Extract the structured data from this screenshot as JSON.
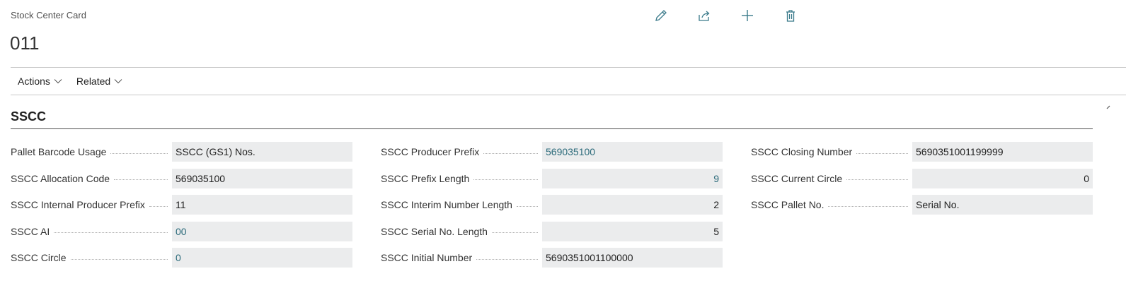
{
  "header": {
    "caption": "Stock Center Card",
    "title": "011"
  },
  "toolbar": {
    "icons": [
      "edit-icon",
      "share-icon",
      "new-icon",
      "delete-icon"
    ]
  },
  "actionbar": {
    "actions_label": "Actions",
    "related_label": "Related"
  },
  "section": {
    "title": "SSCC"
  },
  "fields": {
    "col1": [
      {
        "label": "Pallet Barcode Usage",
        "value": "SSCC (GS1) Nos."
      },
      {
        "label": "SSCC Allocation Code",
        "value": "569035100"
      },
      {
        "label": "SSCC Internal Producer Prefix",
        "value": "11"
      },
      {
        "label": "SSCC AI",
        "value": "00"
      },
      {
        "label": "SSCC Circle",
        "value": "0"
      }
    ],
    "col2": [
      {
        "label": "SSCC Producer Prefix",
        "value": "569035100"
      },
      {
        "label": "SSCC Prefix Length",
        "value": "9"
      },
      {
        "label": "SSCC Interim Number Length",
        "value": "2"
      },
      {
        "label": "SSCC Serial No. Length",
        "value": "5"
      },
      {
        "label": "SSCC Initial Number",
        "value": "5690351001100000"
      }
    ],
    "col3": [
      {
        "label": "SSCC Closing Number",
        "value": "5690351001199999"
      },
      {
        "label": "SSCC Current Circle",
        "value": "0"
      },
      {
        "label": "SSCC Pallet No.",
        "value": "Serial No."
      }
    ]
  },
  "colors": {
    "link": "#2b6a7a",
    "icon": "#3a7a8a",
    "field_bg": "#ebeced"
  }
}
